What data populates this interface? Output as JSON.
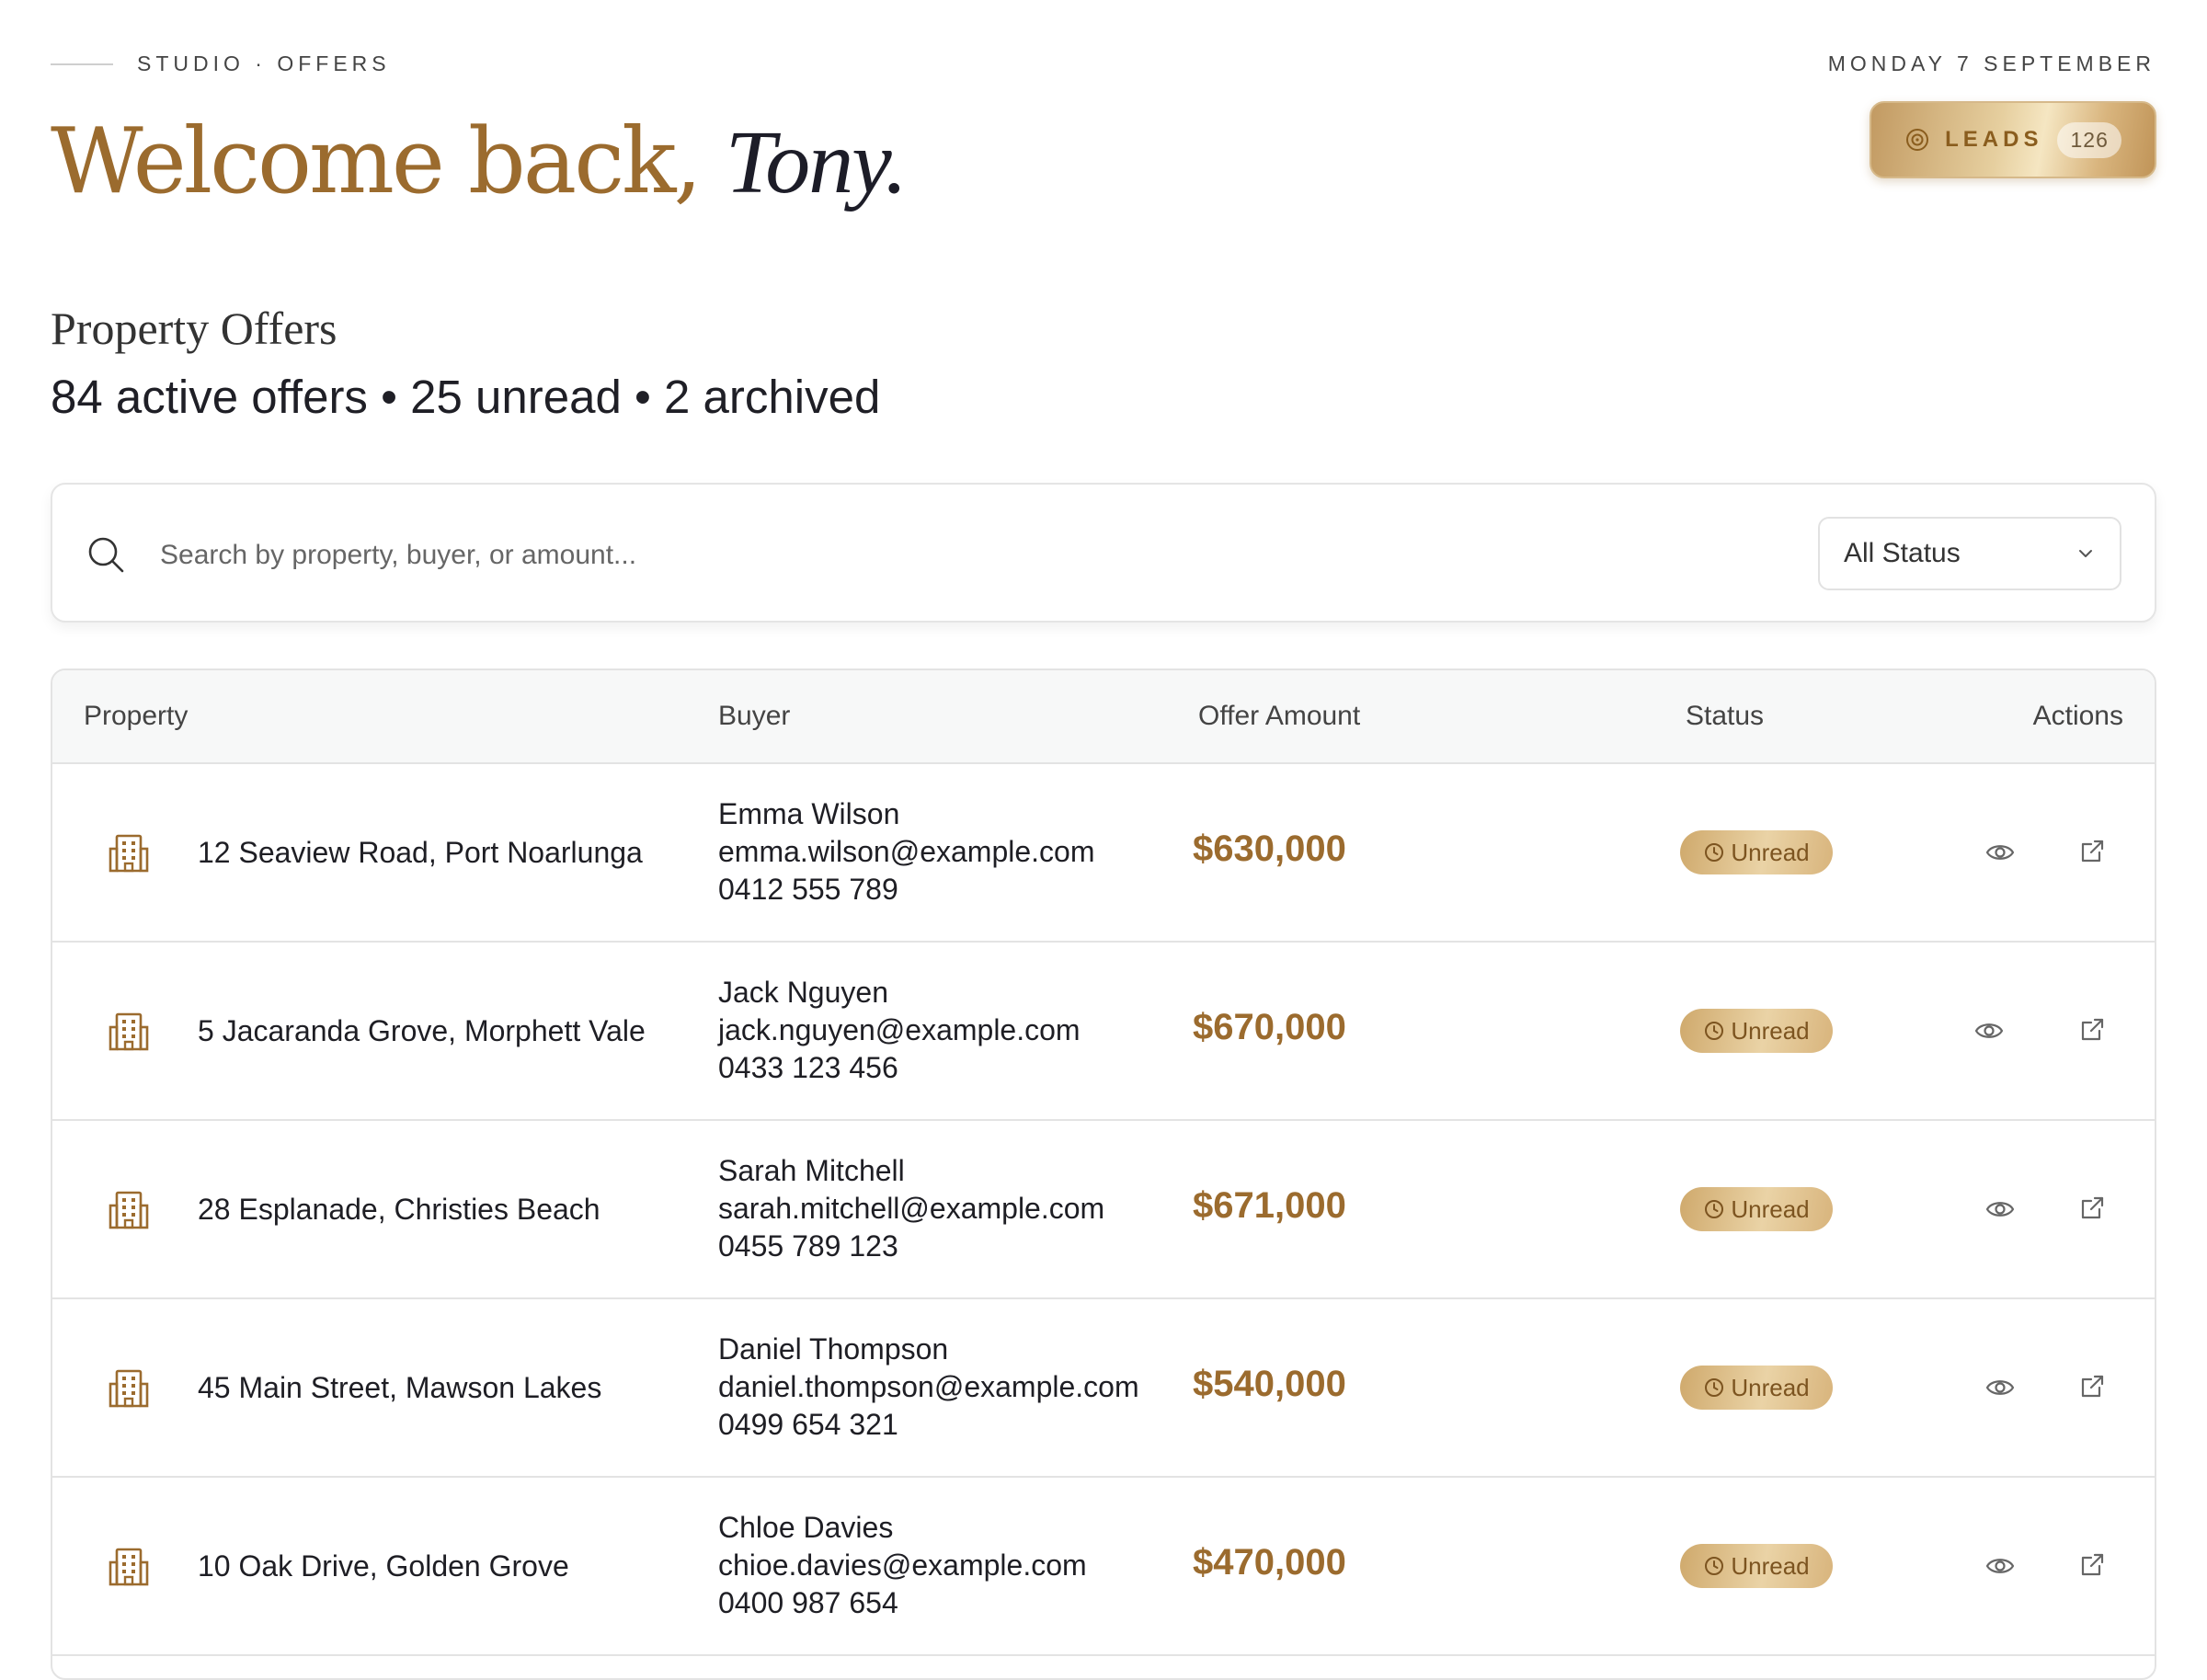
{
  "header": {
    "breadcrumb": "STUDIO · OFFERS",
    "date": "MONDAY 7 SEPTEMBER",
    "welcome_prefix": "Welcome back,",
    "user_name": "Tony."
  },
  "leads_button": {
    "label": "LEADS",
    "count": "126",
    "icon": "target-icon"
  },
  "section": {
    "title": "Property Offers",
    "summary": "84 active offers • 25 unread • 2 archived"
  },
  "search": {
    "placeholder": "Search by property, buyer, or amount...",
    "value": ""
  },
  "status_filter": {
    "selected": "All Status"
  },
  "table": {
    "columns": [
      "Property",
      "Buyer",
      "Offer Amount",
      "Status",
      "Actions"
    ],
    "rows": [
      {
        "property": "12 Seaview Road, Port Noarlunga",
        "buyer_name": "Emma Wilson",
        "buyer_email": "emma.wilson@example.com",
        "buyer_phone": "0412 555 789",
        "amount": "$630,000",
        "status": "Unread"
      },
      {
        "property": "5 Jacaranda Grove, Morphett Vale",
        "buyer_name": "Jack Nguyen",
        "buyer_email": "jack.nguyen@example.com",
        "buyer_phone": "0433 123 456",
        "amount": "$670,000",
        "status": "Unread"
      },
      {
        "property": "28 Esplanade, Christies Beach",
        "buyer_name": "Sarah Mitchell",
        "buyer_email": "sarah.mitchell@example.com",
        "buyer_phone": "0455 789 123",
        "amount": "$671,000",
        "status": "Unread"
      },
      {
        "property": "45 Main Street, Mawson Lakes",
        "buyer_name": "Daniel Thompson",
        "buyer_email": "daniel.thompson@example.com",
        "buyer_phone": "0499 654 321",
        "amount": "$540,000",
        "status": "Unread"
      },
      {
        "property": "10 Oak Drive, Golden Grove",
        "buyer_name": "Chloe Davies",
        "buyer_email": "chioe.davies@example.com",
        "buyer_phone": "0400 987 654",
        "amount": "$470,000",
        "status": "Unread"
      }
    ]
  },
  "colors": {
    "accent_gold": "#9b6b2e",
    "badge_text": "#7c5420",
    "text": "#1e1e24"
  }
}
